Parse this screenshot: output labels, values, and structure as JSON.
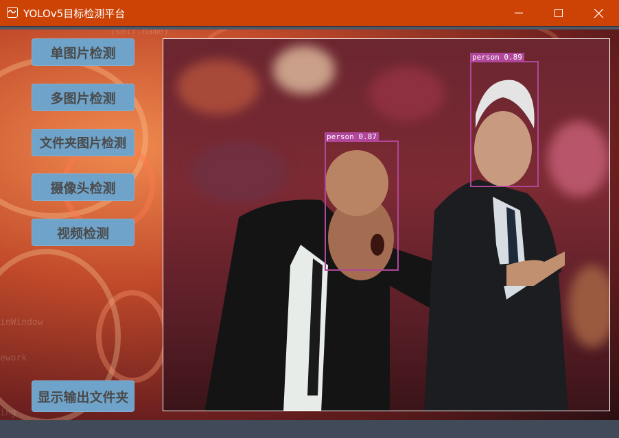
{
  "window": {
    "title": "YOLOv5目标检测平台",
    "controls": [
      "minimize-icon",
      "maximize-icon",
      "close-icon"
    ]
  },
  "sidebar": {
    "buttons": [
      {
        "id": "single",
        "label": "单图片检测"
      },
      {
        "id": "multi",
        "label": "多图片检测"
      },
      {
        "id": "folder",
        "label": "文件夹图片检测"
      },
      {
        "id": "camera",
        "label": "摄像头检测"
      },
      {
        "id": "video",
        "label": "视频检测"
      },
      {
        "id": "output",
        "label": "显示输出文件夹"
      }
    ]
  },
  "result": {
    "detections": [
      {
        "label": "person 0.87"
      },
      {
        "label": "person 0.89"
      }
    ]
  },
  "colors": {
    "titlebar": "#cd4306",
    "button_bg": "#6fa3c9",
    "button_text": "#4a4a4a",
    "detection_box": "#b0479a"
  }
}
